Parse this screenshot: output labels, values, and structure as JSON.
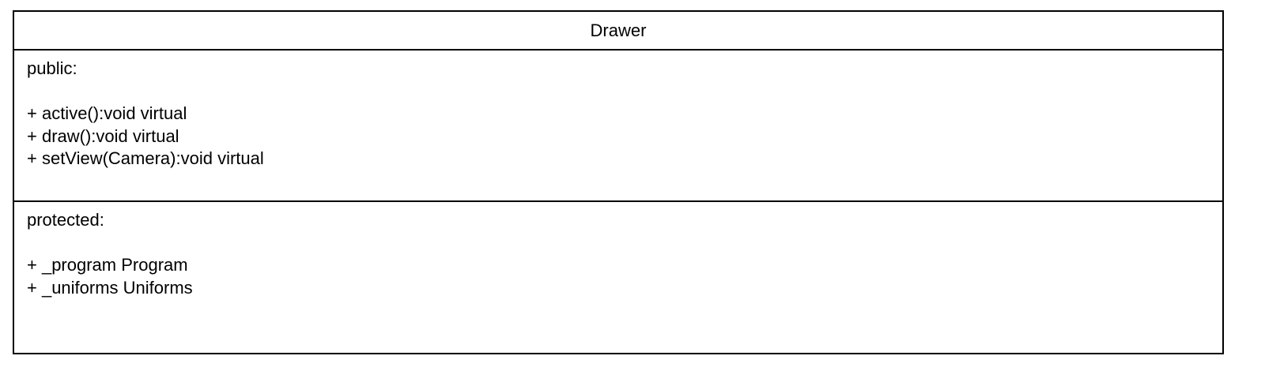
{
  "class": {
    "name": "Drawer",
    "public_section": {
      "title": "public:",
      "members": [
        "+ active():void virtual",
        "+ draw():void virtual",
        "+ setView(Camera):void virtual"
      ]
    },
    "protected_section": {
      "title": "protected:",
      "members": [
        "+ _program Program",
        "+ _uniforms Uniforms"
      ]
    }
  }
}
